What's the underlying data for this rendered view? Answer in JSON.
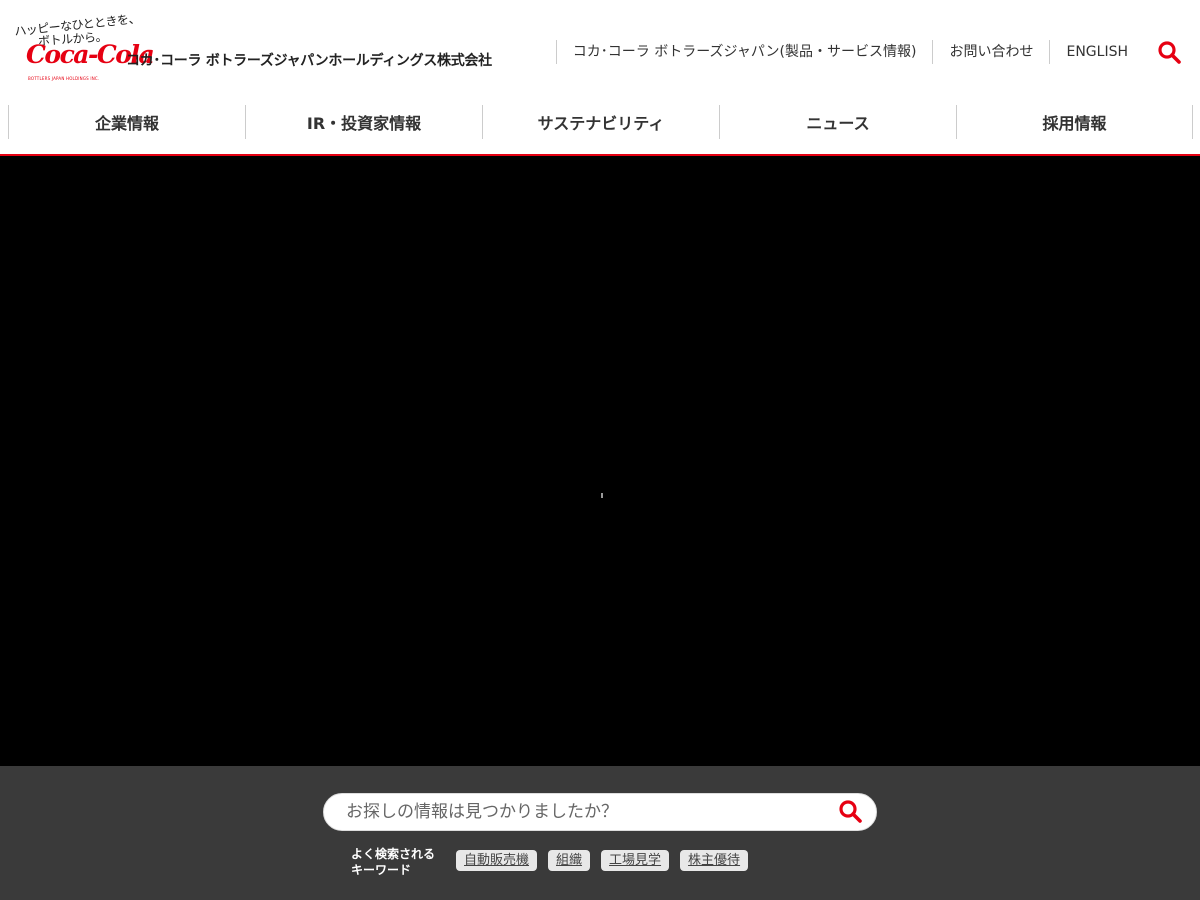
{
  "header": {
    "logo": {
      "tagline_line1": "ハッピーなひとときを、",
      "tagline_line2": "ボトルから。",
      "script_text": "Coca-Cola",
      "sub_text": "BOTTLERS JAPAN HOLDINGS INC."
    },
    "company_name": "コカ･コーラ ボトラーズジャパンホールディングス株式会社",
    "util_nav": [
      {
        "label": "コカ･コーラ ボトラーズジャパン(製品・サービス情報)"
      },
      {
        "label": "お問い合わせ"
      },
      {
        "label": "ENGLISH"
      }
    ],
    "search_icon": "search-icon"
  },
  "global_nav": [
    {
      "label": "企業情報"
    },
    {
      "label": "IR・投資家情報"
    },
    {
      "label": "サステナビリティ"
    },
    {
      "label": "ニュース"
    },
    {
      "label": "採用情報"
    }
  ],
  "search_section": {
    "placeholder": "お探しの情報は見つかりましたか？",
    "keywords_label_line1": "よく検索される",
    "keywords_label_line2": "キーワード",
    "keywords": [
      {
        "label": "自動販売機"
      },
      {
        "label": "組織"
      },
      {
        "label": "工場見学"
      },
      {
        "label": "株主優待"
      }
    ]
  },
  "colors": {
    "brand_red": "#e60012",
    "hero_bg": "#000000",
    "search_bg": "#3a3a3a"
  }
}
